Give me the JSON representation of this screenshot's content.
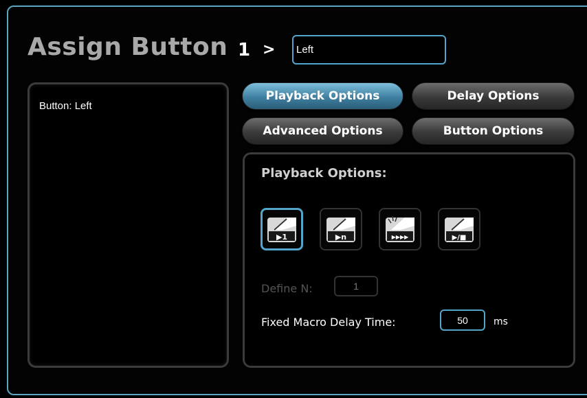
{
  "header": {
    "title": "Assign Button",
    "button_number": "1",
    "chevron": ">",
    "name_value": "Left"
  },
  "left_panel": {
    "text": "Button: Left"
  },
  "tabs": [
    {
      "label": "Playback Options",
      "active": true
    },
    {
      "label": "Delay Options",
      "active": false
    },
    {
      "label": "Advanced Options",
      "active": false
    },
    {
      "label": "Button Options",
      "active": false
    }
  ],
  "playback": {
    "title": "Playback Options:",
    "modes": [
      {
        "icon": "play-once-icon",
        "glyph": "▶1",
        "selected": true
      },
      {
        "icon": "play-n-times-icon",
        "glyph": "▶n",
        "selected": false
      },
      {
        "icon": "play-continuous-icon",
        "glyph": "▶▶▶▶",
        "selected": false
      },
      {
        "icon": "play-toggle-icon",
        "glyph": "▶/■",
        "selected": false
      }
    ],
    "define_n_label": "Define N:",
    "define_n_value": "1",
    "fixed_delay_label": "Fixed Macro Delay Time:",
    "fixed_delay_value": "50",
    "fixed_delay_unit": "ms"
  },
  "colors": {
    "accent": "#54a5cb",
    "active_tab": "#5fa0c0",
    "inactive_tab": "#4a4a4a"
  }
}
